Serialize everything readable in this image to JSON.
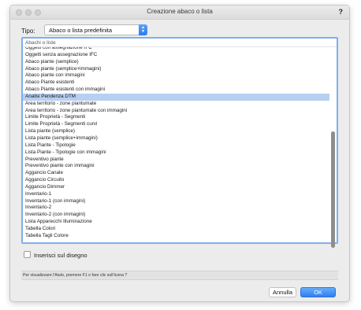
{
  "window": {
    "title": "Creazione abaco o lista",
    "help_glyph": "?"
  },
  "tipo": {
    "label": "Tipo:",
    "value": "Abaco o lista predefinita"
  },
  "list": {
    "header": "Abachi o liste",
    "selected_index": 7,
    "items": [
      "Oggetti con assegnazione IFC",
      "Oggetti senza assegnazione IFC",
      "Abaco piante (semplice)",
      "Abaco piante (semplice+immagini)",
      "Abaco piante con immagini",
      "Abaco Piante esistenti",
      "Abaco Piante esistenti con immagini",
      "Analisi Pendenza DTM",
      "Area territorio - zone piantumate",
      "Area territorio - zone piantumate con immagini",
      "Limite Proprietà - Segmenti",
      "Limite Proprietà - Segmenti curvi",
      "Lista piante (semplice)",
      "Lista piante (semplice+immagini)",
      "Lista Piante - Tipologie",
      "Lista Piante - Tipologie con immagini",
      "Preventivo piante",
      "Preventivo piante con immagini",
      "Aggancio Canale",
      "Aggancio Circuito",
      "Aggancio Dimmer",
      "Inventario-1",
      "Inventario-1 (con immagini)",
      "Inventario-2",
      "Inventario-2 (con immagini)",
      "Lista Apparecchi Illuminazione",
      "Tabella Colori",
      "Tabella Tagli Colore"
    ]
  },
  "checkbox": {
    "label": "Inserisci sul disegno",
    "checked": false
  },
  "help_bar": {
    "text": "Per visualizzare l'Aiuto, premere F1 o fare clic sull'icona ?"
  },
  "buttons": {
    "cancel": "Annulla",
    "ok": "OK"
  },
  "colors": {
    "accent": "#2f80f0",
    "selection": "#b8cff1"
  }
}
